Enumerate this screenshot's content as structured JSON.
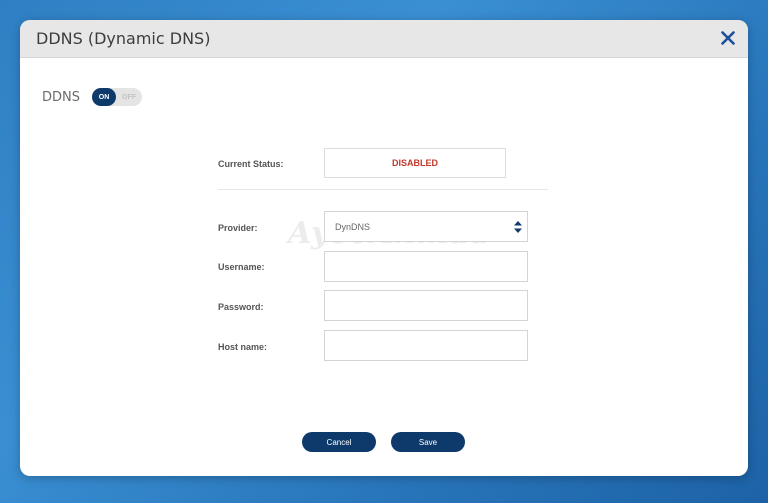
{
  "dialog": {
    "title": "DDNS (Dynamic DNS)",
    "close_icon": "close-icon"
  },
  "ddns": {
    "label": "DDNS",
    "toggle_on": "ON",
    "toggle_off": "OFF",
    "state": "on"
  },
  "status": {
    "label": "Current Status:",
    "value": "DISABLED",
    "color": "#c0392b"
  },
  "provider": {
    "label": "Provider:",
    "value": "DynDNS"
  },
  "username": {
    "label": "Username:",
    "value": ""
  },
  "password": {
    "label": "Password:",
    "value": ""
  },
  "hostname": {
    "label": "Host name:",
    "value": ""
  },
  "buttons": {
    "cancel": "Cancel",
    "save": "Save"
  },
  "watermark": "AyeeAhmad",
  "colors": {
    "accent": "#0e3a6b",
    "close": "#1a4f9a"
  }
}
